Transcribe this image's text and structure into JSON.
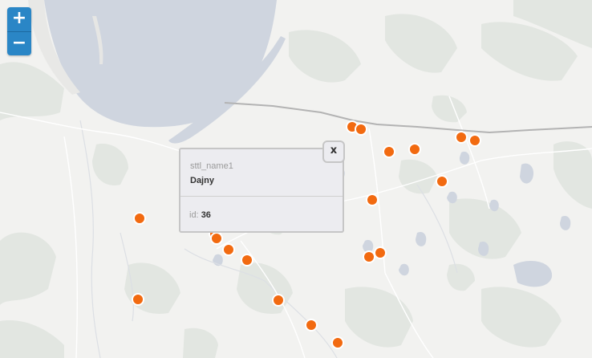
{
  "zoom_controls": {
    "zoom_in": "+",
    "zoom_out": "−"
  },
  "popup": {
    "close_label": "x",
    "field_label": "sttl_name1",
    "field_value": "Dajny",
    "id_label": "id:",
    "id_value": "36"
  },
  "colors": {
    "marker": "#f26a10",
    "marker_outline": "#ffffff",
    "water": "#cfd5df",
    "land": "#f2f2f0",
    "border": "#b3b3b3"
  },
  "icons": {
    "zoom_in": "plus-icon",
    "zoom_out": "minus-icon",
    "marker": "point-marker-icon"
  }
}
